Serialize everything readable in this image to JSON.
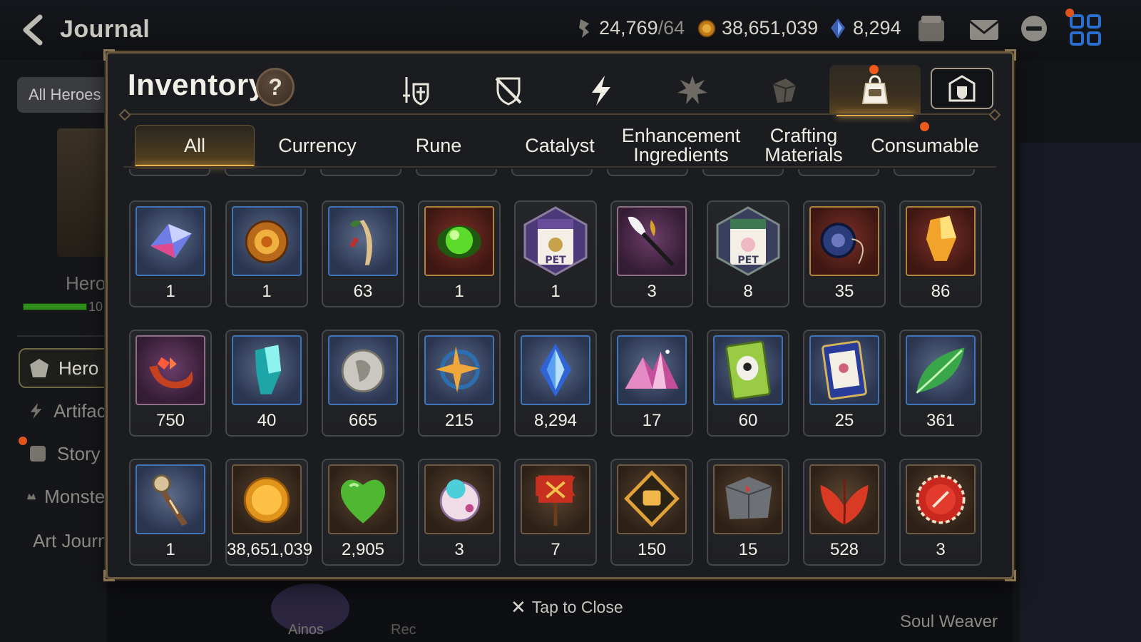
{
  "background": {
    "title": "Journal",
    "resources": [
      {
        "icon": "stamina-icon",
        "value": "24,769",
        "suffix": "/64"
      },
      {
        "icon": "gold-coin-icon",
        "value": "38,651,039"
      },
      {
        "icon": "skystone-icon",
        "value": "8,294"
      }
    ],
    "filter_chip": "All Heroes",
    "hero_text": "Hero",
    "bar_number": "10",
    "menu": [
      {
        "label": "Hero",
        "icon": "hero-icon"
      },
      {
        "label": "Artifact",
        "icon": "artifact-icon"
      },
      {
        "label": "Story",
        "icon": "story-icon"
      },
      {
        "label": "Monster",
        "icon": "monster-icon"
      },
      {
        "label": "Art Journal",
        "icon": "art-icon"
      }
    ],
    "bottom_label": "Ainos",
    "bottom_label_2": "Rec",
    "right_label": "Soul Weaver"
  },
  "inventory": {
    "title": "Inventory",
    "help_label": "?",
    "category_tabs": [
      {
        "icon": "equipment-icon",
        "active": false
      },
      {
        "icon": "no-equipment-icon",
        "active": false
      },
      {
        "icon": "lightning-icon",
        "active": false
      },
      {
        "icon": "artifact-icon",
        "active": false
      },
      {
        "icon": "material-cube-icon",
        "active": false
      },
      {
        "icon": "bag-icon",
        "active": true
      },
      {
        "icon": "storage-icon",
        "active": false
      }
    ],
    "sub_tabs": [
      {
        "label": "All",
        "active": true
      },
      {
        "label": "Currency",
        "active": false
      },
      {
        "label": "Rune",
        "active": false
      },
      {
        "label": "Catalyst",
        "active": false
      },
      {
        "label": "Enhancement Ingredients",
        "active": false
      },
      {
        "label": "Crafting Materials",
        "active": false
      },
      {
        "label": "Consumable",
        "active": false,
        "notification": true
      }
    ],
    "rows": [
      [
        {
          "icon": "blue-crystal-icon",
          "qty": "1"
        },
        {
          "icon": "sun-coin-icon",
          "qty": "1"
        },
        {
          "icon": "ginseng-icon",
          "qty": "63"
        },
        {
          "icon": "green-orb-icon",
          "qty": "1"
        },
        {
          "icon": "pet-pack-purple-icon",
          "qty": "1"
        },
        {
          "icon": "feather-wand-icon",
          "qty": "3"
        },
        {
          "icon": "pet-pack-green-icon",
          "qty": "8"
        },
        {
          "icon": "blue-pendant-icon",
          "qty": "35"
        },
        {
          "icon": "gold-shard-icon",
          "qty": "86"
        }
      ],
      [
        {
          "icon": "red-horn-icon",
          "qty": "750"
        },
        {
          "icon": "teal-crystal-icon",
          "qty": "40"
        },
        {
          "icon": "silver-coin-icon",
          "qty": "665"
        },
        {
          "icon": "star-pendant-icon",
          "qty": "215"
        },
        {
          "icon": "skystone-icon",
          "qty": "8,294"
        },
        {
          "icon": "pink-crystal-pile-icon",
          "qty": "17"
        },
        {
          "icon": "green-card-icon",
          "qty": "60"
        },
        {
          "icon": "blue-card-icon",
          "qty": "25"
        },
        {
          "icon": "green-leaf-icon",
          "qty": "361"
        }
      ],
      [
        {
          "icon": "compass-bookmark-icon",
          "qty": "1"
        },
        {
          "icon": "gold-coin-icon",
          "qty": "38,651,039"
        },
        {
          "icon": "green-heart-icon",
          "qty": "2,905"
        },
        {
          "icon": "robot-ball-icon",
          "qty": "3"
        },
        {
          "icon": "red-banner-icon",
          "qty": "7"
        },
        {
          "icon": "fist-emblem-icon",
          "qty": "150"
        },
        {
          "icon": "stone-cube-icon",
          "qty": "15"
        },
        {
          "icon": "red-leaf-icon",
          "qty": "528"
        },
        {
          "icon": "red-seal-icon",
          "qty": "3"
        }
      ]
    ],
    "close_label": "Tap to Close"
  }
}
